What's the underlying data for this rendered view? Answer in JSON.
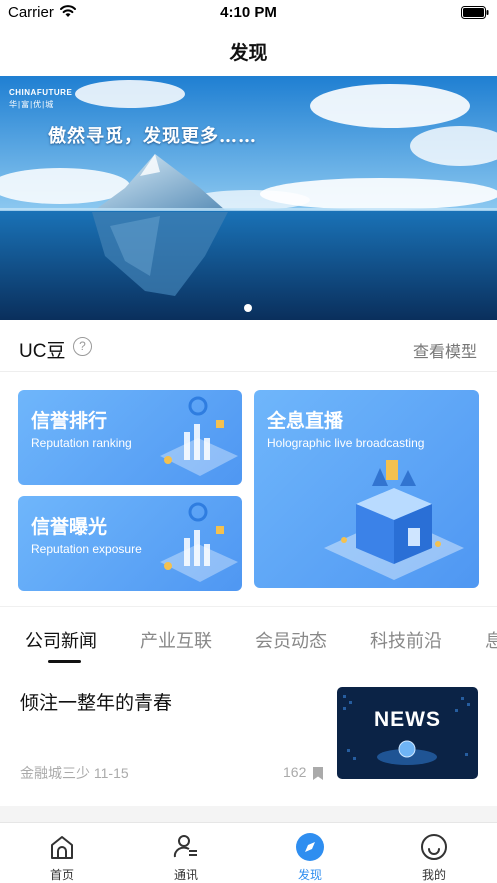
{
  "status_bar": {
    "carrier": "Carrier",
    "time": "4:10 PM"
  },
  "nav": {
    "title": "发现"
  },
  "banner": {
    "logo_top": "CHINAFUTURE",
    "logo_sub": "华|富|优|城",
    "slogan": "傲然寻觅，发现更多……",
    "page_count": 1,
    "active_page": 1
  },
  "uc": {
    "title": "UC豆",
    "help_symbol": "?",
    "link": "查看模型"
  },
  "cards": [
    {
      "title": "信誉排行",
      "subtitle": "Reputation ranking"
    },
    {
      "title": "全息直播",
      "subtitle": "Holographic live broadcasting"
    },
    {
      "title": "信誉曝光",
      "subtitle": "Reputation exposure"
    }
  ],
  "tabs": [
    "公司新闻",
    "产业互联",
    "会员动态",
    "科技前沿",
    "息"
  ],
  "active_tab": 0,
  "news": [
    {
      "title": "倾注一整年的青春",
      "meta": "金融城三少 11-15",
      "count": "162",
      "thumb_text": "NEWS"
    }
  ],
  "tabbar": [
    {
      "label": "首页",
      "icon": "home-icon"
    },
    {
      "label": "通讯",
      "icon": "contacts-icon"
    },
    {
      "label": "发现",
      "icon": "compass-icon"
    },
    {
      "label": "我的",
      "icon": "smile-icon"
    }
  ],
  "active_tabbar": 2,
  "colors": {
    "accent": "#2f8ef0",
    "card_blue": "#5aa4f5",
    "text_primary": "#111111",
    "text_muted": "#888888"
  }
}
